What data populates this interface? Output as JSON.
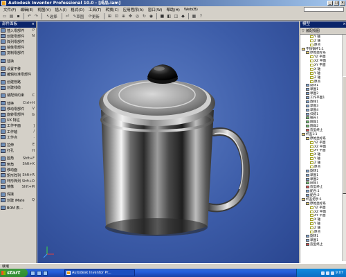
{
  "window": {
    "title": "Autodesk Inventor Professional 10.0 - [成品.iam]",
    "buttons": [
      "_",
      "□",
      "×"
    ]
  },
  "menu": {
    "items": [
      "文件(F)",
      "编辑(E)",
      "视图(V)",
      "插入(I)",
      "格式(O)",
      "工具(T)",
      "转换(C)",
      "应用程序(A)",
      "窗口(W)",
      "帮助(H)",
      "Web(B)"
    ]
  },
  "toolbar": {
    "select_label": "选择",
    "sketch_label": "草图",
    "update_label": "更新"
  },
  "left_panel": {
    "title": "部件面板",
    "close": "×",
    "items": [
      {
        "label": "插入零部件",
        "key": "P"
      },
      {
        "label": "创建零部件",
        "key": "N"
      },
      {
        "label": "阵列零部件",
        "key": ""
      },
      {
        "label": "镜像零部件",
        "key": ""
      },
      {
        "label": "复制零部件",
        "key": ""
      },
      {
        "label": "",
        "key": ""
      },
      {
        "label": "替换",
        "key": ""
      },
      {
        "label": "",
        "key": ""
      },
      {
        "label": "设置平移",
        "key": ""
      },
      {
        "label": "编辑标准零部件",
        "key": ""
      },
      {
        "label": "",
        "key": ""
      },
      {
        "label": "创建管路",
        "key": ""
      },
      {
        "label": "创建线缆",
        "key": ""
      },
      {
        "label": "",
        "key": ""
      },
      {
        "label": "装配体约束",
        "key": "C"
      },
      {
        "label": "",
        "key": ""
      },
      {
        "label": "替换",
        "key": "Ctrl+H"
      },
      {
        "label": "移动零部件",
        "key": "V"
      },
      {
        "label": "旋转零部件",
        "key": "G"
      },
      {
        "label": "UX 特征",
        "key": ""
      },
      {
        "label": "工作平面",
        "key": "]"
      },
      {
        "label": "工作轴",
        "key": "/"
      },
      {
        "label": "工作点",
        "key": "."
      },
      {
        "label": "",
        "key": ""
      },
      {
        "label": "拉伸",
        "key": "E"
      },
      {
        "label": "打孔",
        "key": "H"
      },
      {
        "label": "",
        "key": ""
      },
      {
        "label": "圆角",
        "key": "Shft+F"
      },
      {
        "label": "倒角",
        "key": "Shft+K"
      },
      {
        "label": "移动面",
        "key": ""
      },
      {
        "label": "矩形阵列",
        "key": "Shft+R"
      },
      {
        "label": "环形阵列",
        "key": "Shft+O"
      },
      {
        "label": "镜像",
        "key": "Shft+M"
      },
      {
        "label": "",
        "key": ""
      },
      {
        "label": "焊接",
        "key": ""
      },
      {
        "label": "创建 iMate",
        "key": "Q"
      },
      {
        "label": "",
        "key": ""
      },
      {
        "label": "BOM 表...",
        "key": ""
      }
    ]
  },
  "right_panel": {
    "title": "模型",
    "close": "×",
    "filter_label": "装配视图",
    "tree": [
      {
        "indent": 2,
        "icon": "axis",
        "label": "Y 轴"
      },
      {
        "indent": 2,
        "icon": "axis",
        "label": "Z 轴"
      },
      {
        "indent": 2,
        "icon": "axis",
        "label": "原点"
      },
      {
        "indent": 0,
        "icon": "yellow",
        "label": "不锈钢杯1:1"
      },
      {
        "indent": 1,
        "icon": "yellow",
        "label": "原始坐标系"
      },
      {
        "indent": 2,
        "icon": "axis",
        "label": "YZ 平面"
      },
      {
        "indent": 2,
        "icon": "axis",
        "label": "XZ 平面"
      },
      {
        "indent": 2,
        "icon": "axis",
        "label": "XY 平面"
      },
      {
        "indent": 2,
        "icon": "axis",
        "label": "X 轴"
      },
      {
        "indent": 2,
        "icon": "axis",
        "label": "Y 轴"
      },
      {
        "indent": 2,
        "icon": "axis",
        "label": "Z 轴"
      },
      {
        "indent": 2,
        "icon": "axis",
        "label": "原点"
      },
      {
        "indent": 1,
        "icon": "blue",
        "label": "旋转1"
      },
      {
        "indent": 1,
        "icon": "blue",
        "label": "草图1"
      },
      {
        "indent": 1,
        "icon": "blue",
        "label": "草图2"
      },
      {
        "indent": 1,
        "icon": "blue",
        "label": "工作平面1"
      },
      {
        "indent": 1,
        "icon": "blue",
        "label": "放样1"
      },
      {
        "indent": 1,
        "icon": "blue",
        "label": "草图3"
      },
      {
        "indent": 1,
        "icon": "blue",
        "label": "草图4"
      },
      {
        "indent": 1,
        "icon": "blue",
        "label": "扫掠1"
      },
      {
        "indent": 1,
        "icon": "green",
        "label": "抽壳1"
      },
      {
        "indent": 1,
        "icon": "green",
        "label": "圆角1"
      },
      {
        "indent": 1,
        "icon": "green",
        "label": "圆角2"
      },
      {
        "indent": 1,
        "icon": "red",
        "label": "造型终止"
      },
      {
        "indent": 0,
        "icon": "yellow",
        "label": "杯盖1:1"
      },
      {
        "indent": 1,
        "icon": "yellow",
        "label": "原始坐标系"
      },
      {
        "indent": 2,
        "icon": "axis",
        "label": "YZ 平面"
      },
      {
        "indent": 2,
        "icon": "axis",
        "label": "XZ 平面"
      },
      {
        "indent": 2,
        "icon": "axis",
        "label": "XY 平面"
      },
      {
        "indent": 2,
        "icon": "axis",
        "label": "X 轴"
      },
      {
        "indent": 2,
        "icon": "axis",
        "label": "Y 轴"
      },
      {
        "indent": 2,
        "icon": "axis",
        "label": "Z 轴"
      },
      {
        "indent": 2,
        "icon": "axis",
        "label": "原点"
      },
      {
        "indent": 1,
        "icon": "blue",
        "label": "旋转1"
      },
      {
        "indent": 1,
        "icon": "blue",
        "label": "草图1"
      },
      {
        "indent": 1,
        "icon": "blue",
        "label": "草图2"
      },
      {
        "indent": 1,
        "icon": "green",
        "label": "圆角1"
      },
      {
        "indent": 1,
        "icon": "red",
        "label": "造型终止"
      },
      {
        "indent": 1,
        "icon": "blue",
        "label": "配合:1"
      },
      {
        "indent": 1,
        "icon": "blue",
        "label": "配合:2"
      },
      {
        "indent": 0,
        "icon": "yellow",
        "label": "杯盖把手:1"
      },
      {
        "indent": 1,
        "icon": "yellow",
        "label": "原始坐标系"
      },
      {
        "indent": 2,
        "icon": "axis",
        "label": "YZ 平面"
      },
      {
        "indent": 2,
        "icon": "axis",
        "label": "XZ 平面"
      },
      {
        "indent": 2,
        "icon": "axis",
        "label": "XY 平面"
      },
      {
        "indent": 2,
        "icon": "axis",
        "label": "X 轴"
      },
      {
        "indent": 2,
        "icon": "axis",
        "label": "Y 轴"
      },
      {
        "indent": 2,
        "icon": "axis",
        "label": "Z 轴"
      },
      {
        "indent": 2,
        "icon": "axis",
        "label": "原点"
      },
      {
        "indent": 1,
        "icon": "blue",
        "label": "旋转1"
      },
      {
        "indent": 1,
        "icon": "blue",
        "label": "草图1"
      },
      {
        "indent": 1,
        "icon": "red",
        "label": "造型终止"
      }
    ]
  },
  "status": {
    "text": "就绪"
  },
  "taskbar": {
    "start_label": "start",
    "task_label": "Autodesk Inventor Pr...",
    "clock": "9:07"
  },
  "colors": {
    "viewport_bg": "#3c5ca8",
    "title_bar": "#0a246a",
    "taskbar": "#245edb"
  }
}
